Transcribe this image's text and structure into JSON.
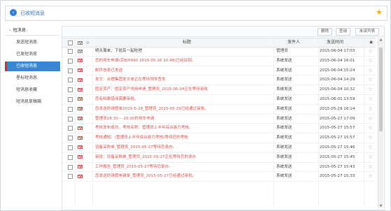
{
  "header": {
    "title": "已收短消息",
    "back_icon": "back-icon",
    "star_icon": "star-icon",
    "star_color": "#f2b01e"
  },
  "sidebar": {
    "title": "短消息",
    "items": [
      {
        "label": "发送短消息",
        "active": false
      },
      {
        "label": "已发短消息",
        "active": false
      },
      {
        "label": "已收短消息",
        "active": true
      },
      {
        "label": "星标短消息",
        "active": false
      },
      {
        "label": "短消息收藏",
        "active": false
      },
      {
        "label": "短消息草稿箱",
        "active": false
      }
    ]
  },
  "toolbar": {
    "delete": "删除",
    "search": "查询",
    "unread": "未读列表"
  },
  "table": {
    "headers": {
      "subject": "标题",
      "sender": "发件人",
      "time": "发送时间"
    },
    "rows": [
      {
        "subject": "明天周末，下班后一起吃吧",
        "sender": "管理员",
        "time": "2015-06-04 17:03",
        "read": true
      },
      {
        "subject": "您的用车申请(京B/0990 2015-05-26 10:48)已经驳回。",
        "sender": "系统发送",
        "time": "2015-06-04 16:01",
        "read": false
      },
      {
        "subject": "邮件信息已发送",
        "sender": "系统发送",
        "time": "2015-06-04 15:24",
        "read": false
      },
      {
        "subject": "发文：合理集团发文单正在等待领导签发",
        "sender": "系统发送",
        "time": "2015-06-04 14:29",
        "read": false
      },
      {
        "subject": "固定资产：固定资产领用申请_管理员_2015-06-04正在等待审批",
        "sender": "系统发送",
        "time": "2015-06-04 10:32",
        "read": false
      },
      {
        "subject": "您有档案借阅需要审批。",
        "sender": "系统发送",
        "time": "2015-06-01 13:59",
        "read": false
      },
      {
        "subject": "您发送的请假单2015-5-29_管理员_2015-05-29已经通过审批。",
        "sender": "系统发送",
        "time": "2015-05-29 16:14",
        "read": false
      },
      {
        "subject": "管理员18:30 -- 20:30的用车申请",
        "sender": "系统发送",
        "time": "2015-05-27 17:09",
        "read": false
      },
      {
        "subject": "考核发布成功，考核名称：管理员上半年综合能力考核。",
        "sender": "系统发送",
        "time": "2015-05-27 15:57",
        "read": false
      },
      {
        "subject": "考核通知：(管理员上半年综合能力考核)等待您的考核",
        "sender": "系统发送",
        "time": "2015-05-27 15:57",
        "read": false
      },
      {
        "subject": "设备采购单_管理员_2015-05-27等待您承办。",
        "sender": "系统发送",
        "time": "2015-05-27 15:46",
        "read": false
      },
      {
        "subject": "审批：设备采购单_管理员_2015-05-27正在等待您的承办",
        "sender": "系统发送",
        "time": "2015-05-27 15:45",
        "read": false
      },
      {
        "subject": "工作报告_管理员_2015-05-27等待您承办。",
        "sender": "系统发送",
        "time": "2015-05-27 15:43",
        "read": false
      },
      {
        "subject": "您发送的请假申请单_管理员_2015-05-27已经通过审批。",
        "sender": "系统发送",
        "time": "2015-05-27 15:33",
        "read": false
      }
    ]
  }
}
